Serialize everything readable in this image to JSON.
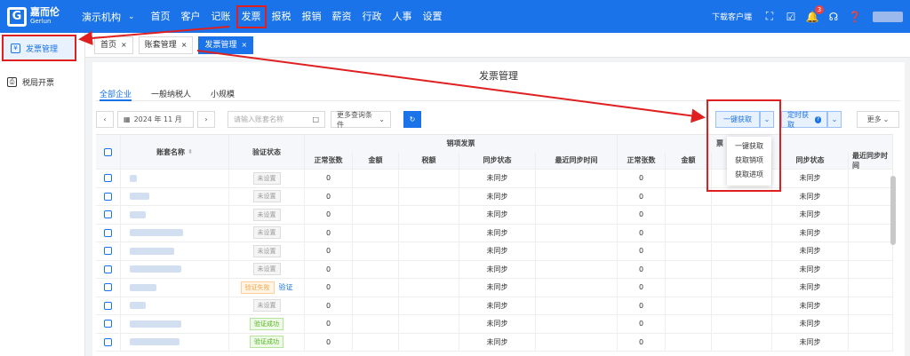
{
  "brand": {
    "name_cn": "嘉而伦",
    "name_en": "Gerlun",
    "color": "#1a73e8"
  },
  "org": {
    "name": "演示机构"
  },
  "nav": [
    {
      "label": "首页"
    },
    {
      "label": "客户"
    },
    {
      "label": "记账"
    },
    {
      "label": "发票",
      "active": true
    },
    {
      "label": "报税"
    },
    {
      "label": "报销"
    },
    {
      "label": "薪资"
    },
    {
      "label": "行政"
    },
    {
      "label": "人事"
    },
    {
      "label": "设置"
    }
  ],
  "header_right": {
    "download_client": "下载客户端",
    "notification_count": "3"
  },
  "sidebar": [
    {
      "label": "发票管理",
      "icon": "invoice-icon",
      "active": true
    },
    {
      "label": "税局开票",
      "icon": "printer-icon",
      "active": false
    }
  ],
  "tabs": [
    {
      "label": "首页",
      "close": "×"
    },
    {
      "label": "账套管理",
      "close": "×"
    },
    {
      "label": "发票管理",
      "close": "×",
      "active": true
    }
  ],
  "page": {
    "title": "发票管理"
  },
  "subtabs": [
    {
      "label": "全部企业",
      "active": true
    },
    {
      "label": "一般纳税人"
    },
    {
      "label": "小规模"
    }
  ],
  "toolbar": {
    "prev": "‹",
    "next": "›",
    "date": "2024 年 11 月",
    "search_placeholder": "请输入账套名称",
    "more_filters": "更多查询条件",
    "one_click_fetch": "一键获取",
    "scheduled_fetch": "定时获取",
    "more": "更多"
  },
  "dropdown": {
    "items": [
      "一键获取",
      "获取销项",
      "获取进项"
    ]
  },
  "table": {
    "group_header_sales": "销项发票",
    "group_header_purchase_visible": "票",
    "columns": {
      "account_name": "账套名称",
      "verify_status": "验证状态",
      "normal_count": "正常张数",
      "amount": "金额",
      "tax": "税额",
      "sync_status": "同步状态",
      "last_sync": "最近同步时间"
    },
    "verify_link": "验证",
    "rows": [
      {
        "status": "未设置",
        "status_type": "none",
        "sales_count": "0",
        "sales_sync": "未同步",
        "purchase_count": "0",
        "purchase_sync": "未同步"
      },
      {
        "status": "未设置",
        "status_type": "none",
        "sales_count": "0",
        "sales_sync": "未同步",
        "purchase_count": "0",
        "purchase_sync": "未同步"
      },
      {
        "status": "未设置",
        "status_type": "none",
        "sales_count": "0",
        "sales_sync": "未同步",
        "purchase_count": "0",
        "purchase_sync": "未同步"
      },
      {
        "status": "未设置",
        "status_type": "none",
        "sales_count": "0",
        "sales_sync": "未同步",
        "purchase_count": "0",
        "purchase_sync": "未同步"
      },
      {
        "status": "未设置",
        "status_type": "none",
        "sales_count": "0",
        "sales_sync": "未同步",
        "purchase_count": "0",
        "purchase_sync": "未同步"
      },
      {
        "status": "未设置",
        "status_type": "none",
        "sales_count": "0",
        "sales_sync": "未同步",
        "purchase_count": "0",
        "purchase_sync": "未同步"
      },
      {
        "status": "验证失败",
        "status_type": "fail",
        "sales_count": "0",
        "sales_sync": "未同步",
        "purchase_count": "0",
        "purchase_sync": "未同步"
      },
      {
        "status": "未设置",
        "status_type": "none",
        "sales_count": "0",
        "sales_sync": "未同步",
        "purchase_count": "0",
        "purchase_sync": "未同步"
      },
      {
        "status": "验证成功",
        "status_type": "ok",
        "sales_count": "0",
        "sales_sync": "未同步",
        "purchase_count": "0",
        "purchase_sync": "未同步"
      },
      {
        "status": "验证成功",
        "status_type": "ok",
        "sales_count": "0",
        "sales_sync": "未同步",
        "purchase_count": "0",
        "purchase_sync": "未同步"
      }
    ]
  }
}
